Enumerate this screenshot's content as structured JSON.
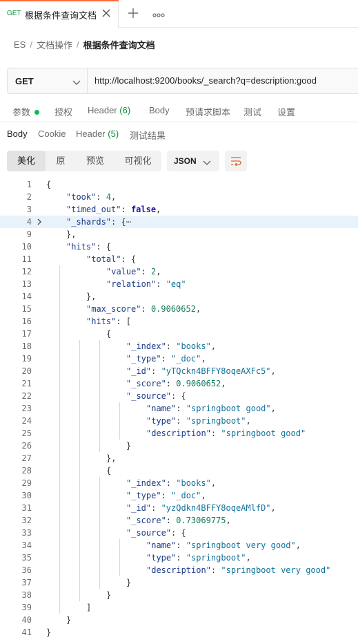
{
  "tab": {
    "method": "GET",
    "title": "根据条件查询文档",
    "close_icon": "close-icon",
    "new_tab_icon": "plus-icon",
    "more_icon": "more-icon",
    "accent_color": "#ff6c37"
  },
  "breadcrumb": {
    "items": [
      "ES",
      "文档操作",
      "根据条件查询文档"
    ],
    "separator": "/"
  },
  "request": {
    "method": "GET",
    "url": "http://localhost:9200/books/_search?q=description:good"
  },
  "request_tabs": {
    "params": "参数",
    "auth": "授权",
    "headers_label": "Header",
    "headers_count": "(6)",
    "body": "Body",
    "pre_request": "预请求脚本",
    "tests": "测试",
    "settings": "设置"
  },
  "response_tabs": {
    "body": "Body",
    "cookie": "Cookie",
    "headers_label": "Header",
    "headers_count": "(5)",
    "test_results": "测试结果"
  },
  "toolbar": {
    "view_modes": [
      "美化",
      "原",
      "预览",
      "可视化"
    ],
    "active_view": "美化",
    "format": "JSON",
    "wrap_icon": "wrap-lines-icon"
  },
  "code_lines": [
    {
      "n": "1",
      "fold": "",
      "indent": 0,
      "html": ""
    },
    {
      "n": "2",
      "fold": "",
      "indent": 1
    },
    {
      "n": "3",
      "fold": "",
      "indent": 1
    },
    {
      "n": "4",
      "fold": "collapsed",
      "indent": 1
    },
    {
      "n": "9",
      "fold": "",
      "indent": 1
    },
    {
      "n": "10",
      "fold": "",
      "indent": 1
    },
    {
      "n": "11",
      "fold": "",
      "indent": 2
    },
    {
      "n": "12",
      "fold": "",
      "indent": 3
    },
    {
      "n": "13",
      "fold": "",
      "indent": 3
    },
    {
      "n": "14",
      "fold": "",
      "indent": 2
    },
    {
      "n": "15",
      "fold": "",
      "indent": 2
    },
    {
      "n": "16",
      "fold": "",
      "indent": 2
    },
    {
      "n": "17",
      "fold": "",
      "indent": 3
    },
    {
      "n": "18",
      "fold": "",
      "indent": 4
    },
    {
      "n": "19",
      "fold": "",
      "indent": 4
    },
    {
      "n": "20",
      "fold": "",
      "indent": 4
    },
    {
      "n": "21",
      "fold": "",
      "indent": 4
    },
    {
      "n": "22",
      "fold": "",
      "indent": 4
    },
    {
      "n": "23",
      "fold": "",
      "indent": 5
    },
    {
      "n": "24",
      "fold": "",
      "indent": 5
    },
    {
      "n": "25",
      "fold": "",
      "indent": 5
    },
    {
      "n": "26",
      "fold": "",
      "indent": 4
    },
    {
      "n": "27",
      "fold": "",
      "indent": 3
    },
    {
      "n": "28",
      "fold": "",
      "indent": 3
    },
    {
      "n": "29",
      "fold": "",
      "indent": 4
    },
    {
      "n": "30",
      "fold": "",
      "indent": 4
    },
    {
      "n": "31",
      "fold": "",
      "indent": 4
    },
    {
      "n": "32",
      "fold": "",
      "indent": 4
    },
    {
      "n": "33",
      "fold": "",
      "indent": 4
    },
    {
      "n": "34",
      "fold": "",
      "indent": 5
    },
    {
      "n": "35",
      "fold": "",
      "indent": 5
    },
    {
      "n": "36",
      "fold": "",
      "indent": 5
    },
    {
      "n": "37",
      "fold": "",
      "indent": 4
    },
    {
      "n": "38",
      "fold": "",
      "indent": 3
    },
    {
      "n": "39",
      "fold": "",
      "indent": 2
    },
    {
      "n": "40",
      "fold": "",
      "indent": 1
    },
    {
      "n": "41",
      "fold": "",
      "indent": 0
    }
  ],
  "code_tokens": [
    [
      [
        "p",
        "{"
      ]
    ],
    [
      [
        "k",
        "\"took\""
      ],
      [
        "p",
        ": "
      ],
      [
        "n",
        "4"
      ],
      [
        "p",
        ","
      ]
    ],
    [
      [
        "k",
        "\"timed_out\""
      ],
      [
        "p",
        ": "
      ],
      [
        "w",
        "false"
      ],
      [
        "p",
        ","
      ]
    ],
    [
      [
        "k",
        "\"_shards\""
      ],
      [
        "p",
        ": {"
      ],
      [
        "e",
        "⋯"
      ]
    ],
    [
      [
        "p",
        "},"
      ]
    ],
    [
      [
        "k",
        "\"hits\""
      ],
      [
        "p",
        ": {"
      ]
    ],
    [
      [
        "k",
        "\"total\""
      ],
      [
        "p",
        ": {"
      ]
    ],
    [
      [
        "k",
        "\"value\""
      ],
      [
        "p",
        ": "
      ],
      [
        "n",
        "2"
      ],
      [
        "p",
        ","
      ]
    ],
    [
      [
        "k",
        "\"relation\""
      ],
      [
        "p",
        ": "
      ],
      [
        "s",
        "\"eq\""
      ]
    ],
    [
      [
        "p",
        "},"
      ]
    ],
    [
      [
        "k",
        "\"max_score\""
      ],
      [
        "p",
        ": "
      ],
      [
        "n",
        "0.9060652"
      ],
      [
        "p",
        ","
      ]
    ],
    [
      [
        "k",
        "\"hits\""
      ],
      [
        "p",
        ": ["
      ]
    ],
    [
      [
        "p",
        "{"
      ]
    ],
    [
      [
        "k",
        "\"_index\""
      ],
      [
        "p",
        ": "
      ],
      [
        "s",
        "\"books\""
      ],
      [
        "p",
        ","
      ]
    ],
    [
      [
        "k",
        "\"_type\""
      ],
      [
        "p",
        ": "
      ],
      [
        "s",
        "\"_doc\""
      ],
      [
        "p",
        ","
      ]
    ],
    [
      [
        "k",
        "\"_id\""
      ],
      [
        "p",
        ": "
      ],
      [
        "s",
        "\"yTQckn4BFFY8oqeAXFc5\""
      ],
      [
        "p",
        ","
      ]
    ],
    [
      [
        "k",
        "\"_score\""
      ],
      [
        "p",
        ": "
      ],
      [
        "n",
        "0.9060652"
      ],
      [
        "p",
        ","
      ]
    ],
    [
      [
        "k",
        "\"_source\""
      ],
      [
        "p",
        ": {"
      ]
    ],
    [
      [
        "k",
        "\"name\""
      ],
      [
        "p",
        ": "
      ],
      [
        "s",
        "\"springboot good\""
      ],
      [
        "p",
        ","
      ]
    ],
    [
      [
        "k",
        "\"type\""
      ],
      [
        "p",
        ": "
      ],
      [
        "s",
        "\"springboot\""
      ],
      [
        "p",
        ","
      ]
    ],
    [
      [
        "k",
        "\"description\""
      ],
      [
        "p",
        ": "
      ],
      [
        "s",
        "\"springboot good\""
      ]
    ],
    [
      [
        "p",
        "}"
      ]
    ],
    [
      [
        "p",
        "},"
      ]
    ],
    [
      [
        "p",
        "{"
      ]
    ],
    [
      [
        "k",
        "\"_index\""
      ],
      [
        "p",
        ": "
      ],
      [
        "s",
        "\"books\""
      ],
      [
        "p",
        ","
      ]
    ],
    [
      [
        "k",
        "\"_type\""
      ],
      [
        "p",
        ": "
      ],
      [
        "s",
        "\"_doc\""
      ],
      [
        "p",
        ","
      ]
    ],
    [
      [
        "k",
        "\"_id\""
      ],
      [
        "p",
        ": "
      ],
      [
        "s",
        "\"yzQdkn4BFFY8oqeAMlfD\""
      ],
      [
        "p",
        ","
      ]
    ],
    [
      [
        "k",
        "\"_score\""
      ],
      [
        "p",
        ": "
      ],
      [
        "n",
        "0.73069775"
      ],
      [
        "p",
        ","
      ]
    ],
    [
      [
        "k",
        "\"_source\""
      ],
      [
        "p",
        ": {"
      ]
    ],
    [
      [
        "k",
        "\"name\""
      ],
      [
        "p",
        ": "
      ],
      [
        "s",
        "\"springboot very good\""
      ],
      [
        "p",
        ","
      ]
    ],
    [
      [
        "k",
        "\"type\""
      ],
      [
        "p",
        ": "
      ],
      [
        "s",
        "\"springboot\""
      ],
      [
        "p",
        ","
      ]
    ],
    [
      [
        "k",
        "\"description\""
      ],
      [
        "p",
        ": "
      ],
      [
        "s",
        "\"springboot very good\""
      ]
    ],
    [
      [
        "p",
        "}"
      ]
    ],
    [
      [
        "p",
        "}"
      ]
    ],
    [
      [
        "p",
        "]"
      ]
    ],
    [
      [
        "p",
        "}"
      ]
    ],
    [
      [
        "p",
        "}"
      ]
    ]
  ],
  "colors": {
    "key": "#1a3a86",
    "string": "#11729c",
    "number": "#137a5b",
    "keyword": "#1a1aa6",
    "highlight_row": "#e8f2fb",
    "status_dot": "#0cbb52"
  }
}
